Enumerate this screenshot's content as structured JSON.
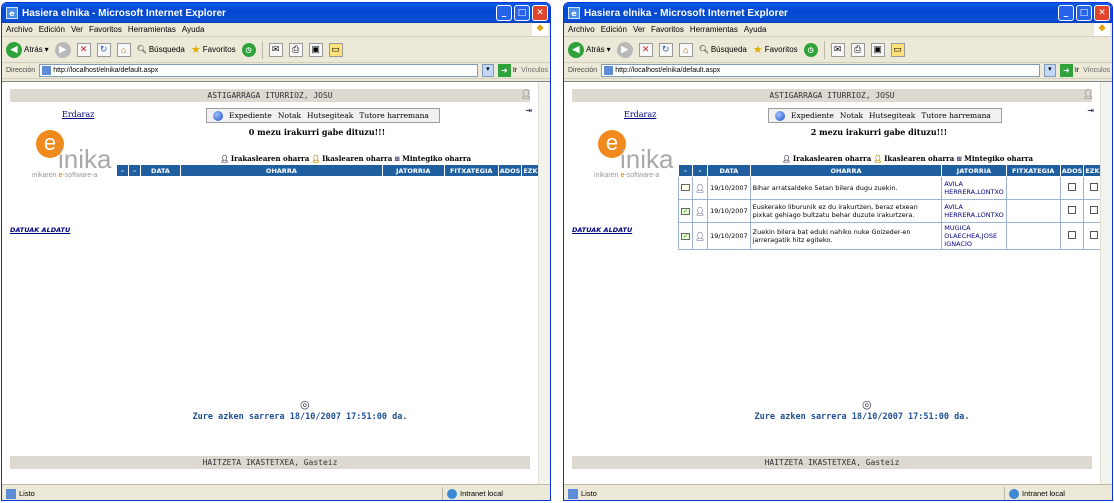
{
  "windows": [
    {
      "title": "Hasiera elnika - Microsoft Internet Explorer",
      "menu": [
        "Archivo",
        "Edición",
        "Ver",
        "Favoritos",
        "Herramientas",
        "Ayuda"
      ],
      "toolbar": {
        "back": "Atrás",
        "search": "Búsqueda",
        "favorites": "Favoritos"
      },
      "address": {
        "label": "Dirección",
        "url": "http://localhost/elnika/default.aspx",
        "go": "Ir",
        "links": "Vínculos"
      },
      "user_name": "ASTIGARRAGA ITURRIOZ, JOSU",
      "language_link": "Erdaraz",
      "nav": [
        "Expediente",
        "Notak",
        "Hutsegiteak",
        "Tutore harremana"
      ],
      "unread": "0 mezu irakurri gabe dituzu!!!",
      "logo": {
        "letter": "e",
        "word": "inika",
        "tag_prefix": "inikaren ",
        "tag_e": "e",
        "tag_suffix": "-software-a"
      },
      "tabs": [
        "Irakaslearen oharra",
        "Ikaslearen oharra",
        "Mintegiko oharra"
      ],
      "table_headers": [
        "-",
        "-",
        "DATA",
        "OHARRA",
        "JATORRIA",
        "FITXATEGIA",
        "ADOS",
        "EZK."
      ],
      "rows": [],
      "side_link": "DATUAK ALDATU",
      "last_login": "Zure azken sarrera 18/10/2007 17:51:00 da.",
      "footer": "HAITZETA IKASTETXEA, Gasteiz",
      "status": {
        "text": "Listo",
        "zone": "Intranet local"
      }
    },
    {
      "title": "Hasiera elnika - Microsoft Internet Explorer",
      "menu": [
        "Archivo",
        "Edición",
        "Ver",
        "Favoritos",
        "Herramientas",
        "Ayuda"
      ],
      "toolbar": {
        "back": "Atrás",
        "search": "Búsqueda",
        "favorites": "Favoritos"
      },
      "address": {
        "label": "Dirección",
        "url": "http://localhost/elnika/default.aspx",
        "go": "Ir",
        "links": "Vínculos"
      },
      "user_name": "ASTIGARRAGA ITURRIOZ, JOSU",
      "language_link": "Erdaraz",
      "nav": [
        "Expediente",
        "Notak",
        "Hutsegiteak",
        "Tutore harremana"
      ],
      "unread": "2 mezu irakurri gabe dituzu!!!",
      "logo": {
        "letter": "e",
        "word": "inika",
        "tag_prefix": "inikaren ",
        "tag_e": "e",
        "tag_suffix": "-software-a"
      },
      "tabs": [
        "Irakaslearen oharra",
        "Ikaslearen oharra",
        "Mintegiko oharra"
      ],
      "table_headers": [
        "-",
        "-",
        "DATA",
        "OHARRA",
        "JATORRIA",
        "FITXATEGIA",
        "ADOS",
        "EZK."
      ],
      "rows": [
        {
          "read": false,
          "date": "19/10/2007",
          "note": "Bihar arratsaldeko 5etan bilera dugu zuekin.",
          "origin": "AVILA HERRERA,LONTXO"
        },
        {
          "read": true,
          "date": "19/10/2007",
          "note": "Euskerako liburunik ez du irakurtzen, beraz etxean pixkat gehiago bultzatu behar duzute irakurtzera.",
          "origin": "AVILA HERRERA,LONTXO"
        },
        {
          "read": true,
          "date": "19/10/2007",
          "note": "Zuekin bilera bat eduki nahiko nuke Goizeder-en jarreragatik hitz egiteko.",
          "origin": "MUGICA OLAECHEA,JOSE IGNACIO"
        }
      ],
      "side_link": "DATUAK ALDATU",
      "last_login": "Zure azken sarrera 18/10/2007 17:51:00 da.",
      "footer": "HAITZETA IKASTETXEA, Gasteiz",
      "status": {
        "text": "Listo",
        "zone": "Intranet local"
      }
    }
  ]
}
